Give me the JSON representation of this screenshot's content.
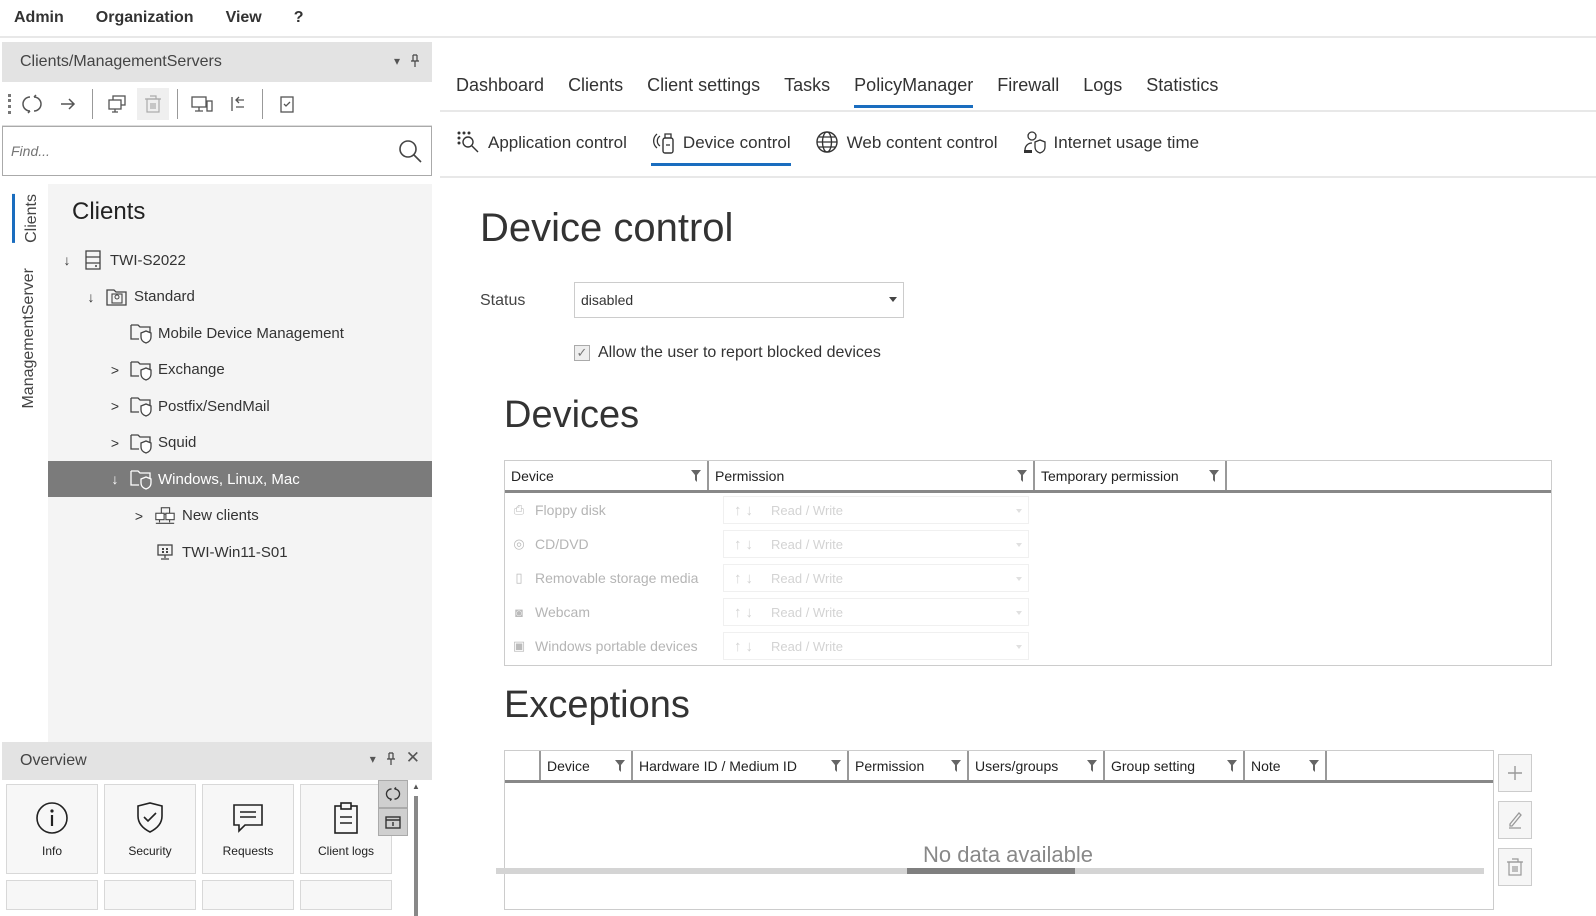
{
  "menu": [
    "Admin",
    "Organization",
    "View",
    "?"
  ],
  "left_panel": {
    "title": "Clients/ManagementServers",
    "search_placeholder": "Find...",
    "vertical_tabs": [
      "Clients",
      "ManagementServer"
    ],
    "tree_title": "Clients",
    "tree": [
      {
        "label": "TWI-S2022",
        "expander": "↓",
        "icon": "server-icon",
        "level": 0
      },
      {
        "label": "Standard",
        "expander": "↓",
        "icon": "group-folder-icon",
        "level": 1
      },
      {
        "label": "Mobile Device Management",
        "expander": "",
        "icon": "policy-folder-icon",
        "level": 2
      },
      {
        "label": "Exchange",
        "expander": ">",
        "icon": "policy-folder-icon",
        "level": 2
      },
      {
        "label": "Postfix/SendMail",
        "expander": ">",
        "icon": "policy-folder-icon",
        "level": 2
      },
      {
        "label": "Squid",
        "expander": ">",
        "icon": "policy-folder-icon",
        "level": 2
      },
      {
        "label": "Windows, Linux, Mac",
        "expander": "↓",
        "icon": "policy-folder-icon",
        "level": 2,
        "selected": true
      },
      {
        "label": "New clients",
        "expander": ">",
        "icon": "network-clients-icon",
        "level": 3
      },
      {
        "label": "TWI-Win11-S01",
        "expander": "",
        "icon": "windows-client-icon",
        "level": 3
      }
    ]
  },
  "overview": {
    "title": "Overview",
    "tiles": [
      {
        "label": "Info",
        "icon": "info-icon"
      },
      {
        "label": "Security",
        "icon": "shield-check-icon"
      },
      {
        "label": "Requests",
        "icon": "chat-bubble-icon"
      },
      {
        "label": "Client logs",
        "icon": "clipboard-icon"
      }
    ]
  },
  "main": {
    "tabs": [
      "Dashboard",
      "Clients",
      "Client settings",
      "Tasks",
      "PolicyManager",
      "Firewall",
      "Logs",
      "Statistics"
    ],
    "active_tab": "PolicyManager",
    "subtabs": [
      "Application control",
      "Device control",
      "Web content control",
      "Internet usage time"
    ],
    "active_subtab": "Device control",
    "page_title": "Device control",
    "status_label": "Status",
    "status_value": "disabled",
    "allow_report_label": "Allow the user to report blocked devices",
    "allow_report_checked": true,
    "devices": {
      "title": "Devices",
      "columns": [
        "Device",
        "Permission",
        "Temporary permission"
      ],
      "rows": [
        {
          "device": "Floppy disk",
          "icon": "floppy-icon",
          "permission": "Read / Write"
        },
        {
          "device": "CD/DVD",
          "icon": "disc-icon",
          "permission": "Read / Write"
        },
        {
          "device": "Removable storage media",
          "icon": "usb-icon",
          "permission": "Read / Write"
        },
        {
          "device": "Webcam",
          "icon": "camera-icon",
          "permission": "Read / Write"
        },
        {
          "device": "Windows portable devices",
          "icon": "portable-device-icon",
          "permission": "Read / Write"
        }
      ]
    },
    "exceptions": {
      "title": "Exceptions",
      "columns": [
        "Device",
        "Hardware ID / Medium ID",
        "Permission",
        "Users/groups",
        "Group setting",
        "Note"
      ],
      "empty_text": "No data available"
    }
  }
}
